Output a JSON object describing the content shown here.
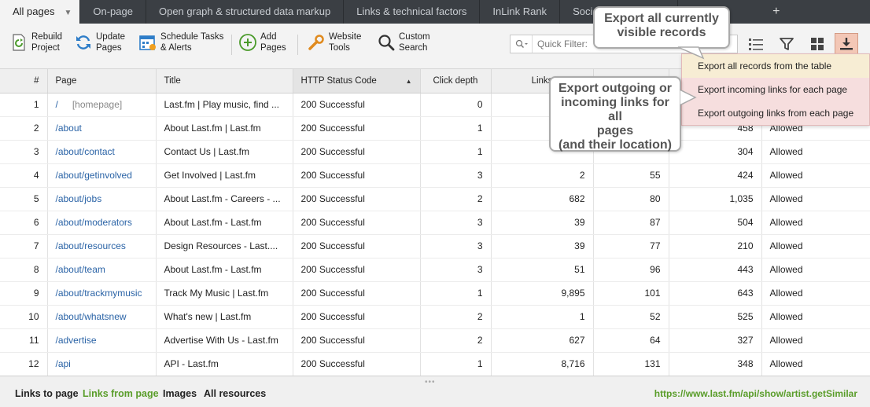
{
  "tabs": [
    {
      "label": "All pages",
      "active": true
    },
    {
      "label": "On-page"
    },
    {
      "label": "Open graph & structured data markup"
    },
    {
      "label": "Links & technical factors"
    },
    {
      "label": "InLink Rank"
    },
    {
      "label": "Social me"
    }
  ],
  "add_tab_label": "+",
  "toolbar": {
    "rebuild": "Rebuild\nProject",
    "update": "Update\nPages",
    "schedule": "Schedule Tasks\n& Alerts",
    "add": "Add\nPages",
    "website_tools": "Website\nTools",
    "custom_search": "Custom\nSearch",
    "quick_filter_placeholder": "Quick Filter: "
  },
  "table": {
    "columns": [
      "#",
      "Page",
      "Title",
      "HTTP Status Code",
      "Click depth",
      "Links",
      "",
      "",
      ""
    ],
    "sorted_column": "HTTP Status Code",
    "rows": [
      {
        "n": "1",
        "page": "/",
        "home": "[homepage]",
        "title": "Last.fm | Play music, find ...",
        "status": "200 Successful",
        "depth": "0",
        "links": "",
        "c6": "",
        "c7": "",
        "robots": ""
      },
      {
        "n": "2",
        "page": "/about",
        "home": "",
        "title": "About Last.fm | Last.fm",
        "status": "200 Successful",
        "depth": "1",
        "links": "",
        "c6": "",
        "c7": "458",
        "robots": "Allowed"
      },
      {
        "n": "3",
        "page": "/about/contact",
        "home": "",
        "title": "Contact Us | Last.fm",
        "status": "200 Successful",
        "depth": "1",
        "links": "",
        "c6": "",
        "c7": "304",
        "robots": "Allowed"
      },
      {
        "n": "4",
        "page": "/about/getinvolved",
        "home": "",
        "title": "Get Involved | Last.fm",
        "status": "200 Successful",
        "depth": "3",
        "links": "2",
        "c6": "55",
        "c7": "424",
        "robots": "Allowed"
      },
      {
        "n": "5",
        "page": "/about/jobs",
        "home": "",
        "title": "About Last.fm - Careers - ...",
        "status": "200 Successful",
        "depth": "2",
        "links": "682",
        "c6": "80",
        "c7": "1,035",
        "robots": "Allowed"
      },
      {
        "n": "6",
        "page": "/about/moderators",
        "home": "",
        "title": "About Last.fm - Last.fm",
        "status": "200 Successful",
        "depth": "3",
        "links": "39",
        "c6": "87",
        "c7": "504",
        "robots": "Allowed"
      },
      {
        "n": "7",
        "page": "/about/resources",
        "home": "",
        "title": "Design Resources - Last....",
        "status": "200 Successful",
        "depth": "3",
        "links": "39",
        "c6": "77",
        "c7": "210",
        "robots": "Allowed"
      },
      {
        "n": "8",
        "page": "/about/team",
        "home": "",
        "title": "About Last.fm - Last.fm",
        "status": "200 Successful",
        "depth": "3",
        "links": "51",
        "c6": "96",
        "c7": "443",
        "robots": "Allowed"
      },
      {
        "n": "9",
        "page": "/about/trackmymusic",
        "home": "",
        "title": "Track My Music | Last.fm",
        "status": "200 Successful",
        "depth": "1",
        "links": "9,895",
        "c6": "101",
        "c7": "643",
        "robots": "Allowed"
      },
      {
        "n": "10",
        "page": "/about/whatsnew",
        "home": "",
        "title": "What's new | Last.fm",
        "status": "200 Successful",
        "depth": "2",
        "links": "1",
        "c6": "52",
        "c7": "525",
        "robots": "Allowed"
      },
      {
        "n": "11",
        "page": "/advertise",
        "home": "",
        "title": "Advertise With Us - Last.fm",
        "status": "200 Successful",
        "depth": "2",
        "links": "627",
        "c6": "64",
        "c7": "327",
        "robots": "Allowed"
      },
      {
        "n": "12",
        "page": "/api",
        "home": "",
        "title": "API - Last.fm",
        "status": "200 Successful",
        "depth": "1",
        "links": "8,716",
        "c6": "131",
        "c7": "348",
        "robots": "Allowed"
      }
    ]
  },
  "export_menu": [
    "Export all records from the table",
    "Export incoming links for each page",
    "Export outgoing links from each page"
  ],
  "callouts": {
    "visible": "Export all currently\nvisible records",
    "links": "Export outgoing or\nincoming links for all\npages\n(and their location)"
  },
  "bottom": {
    "tabs": [
      "Links to page",
      "Links from page",
      "Images",
      "All resources"
    ],
    "active_tab": "Links from page",
    "url": "https://www.last.fm/api/show/artist.getSimilar"
  },
  "colors": {
    "accent_green": "#5a9d2a",
    "link_blue": "#2a63a6",
    "export_highlight": "#f3c7b6"
  }
}
